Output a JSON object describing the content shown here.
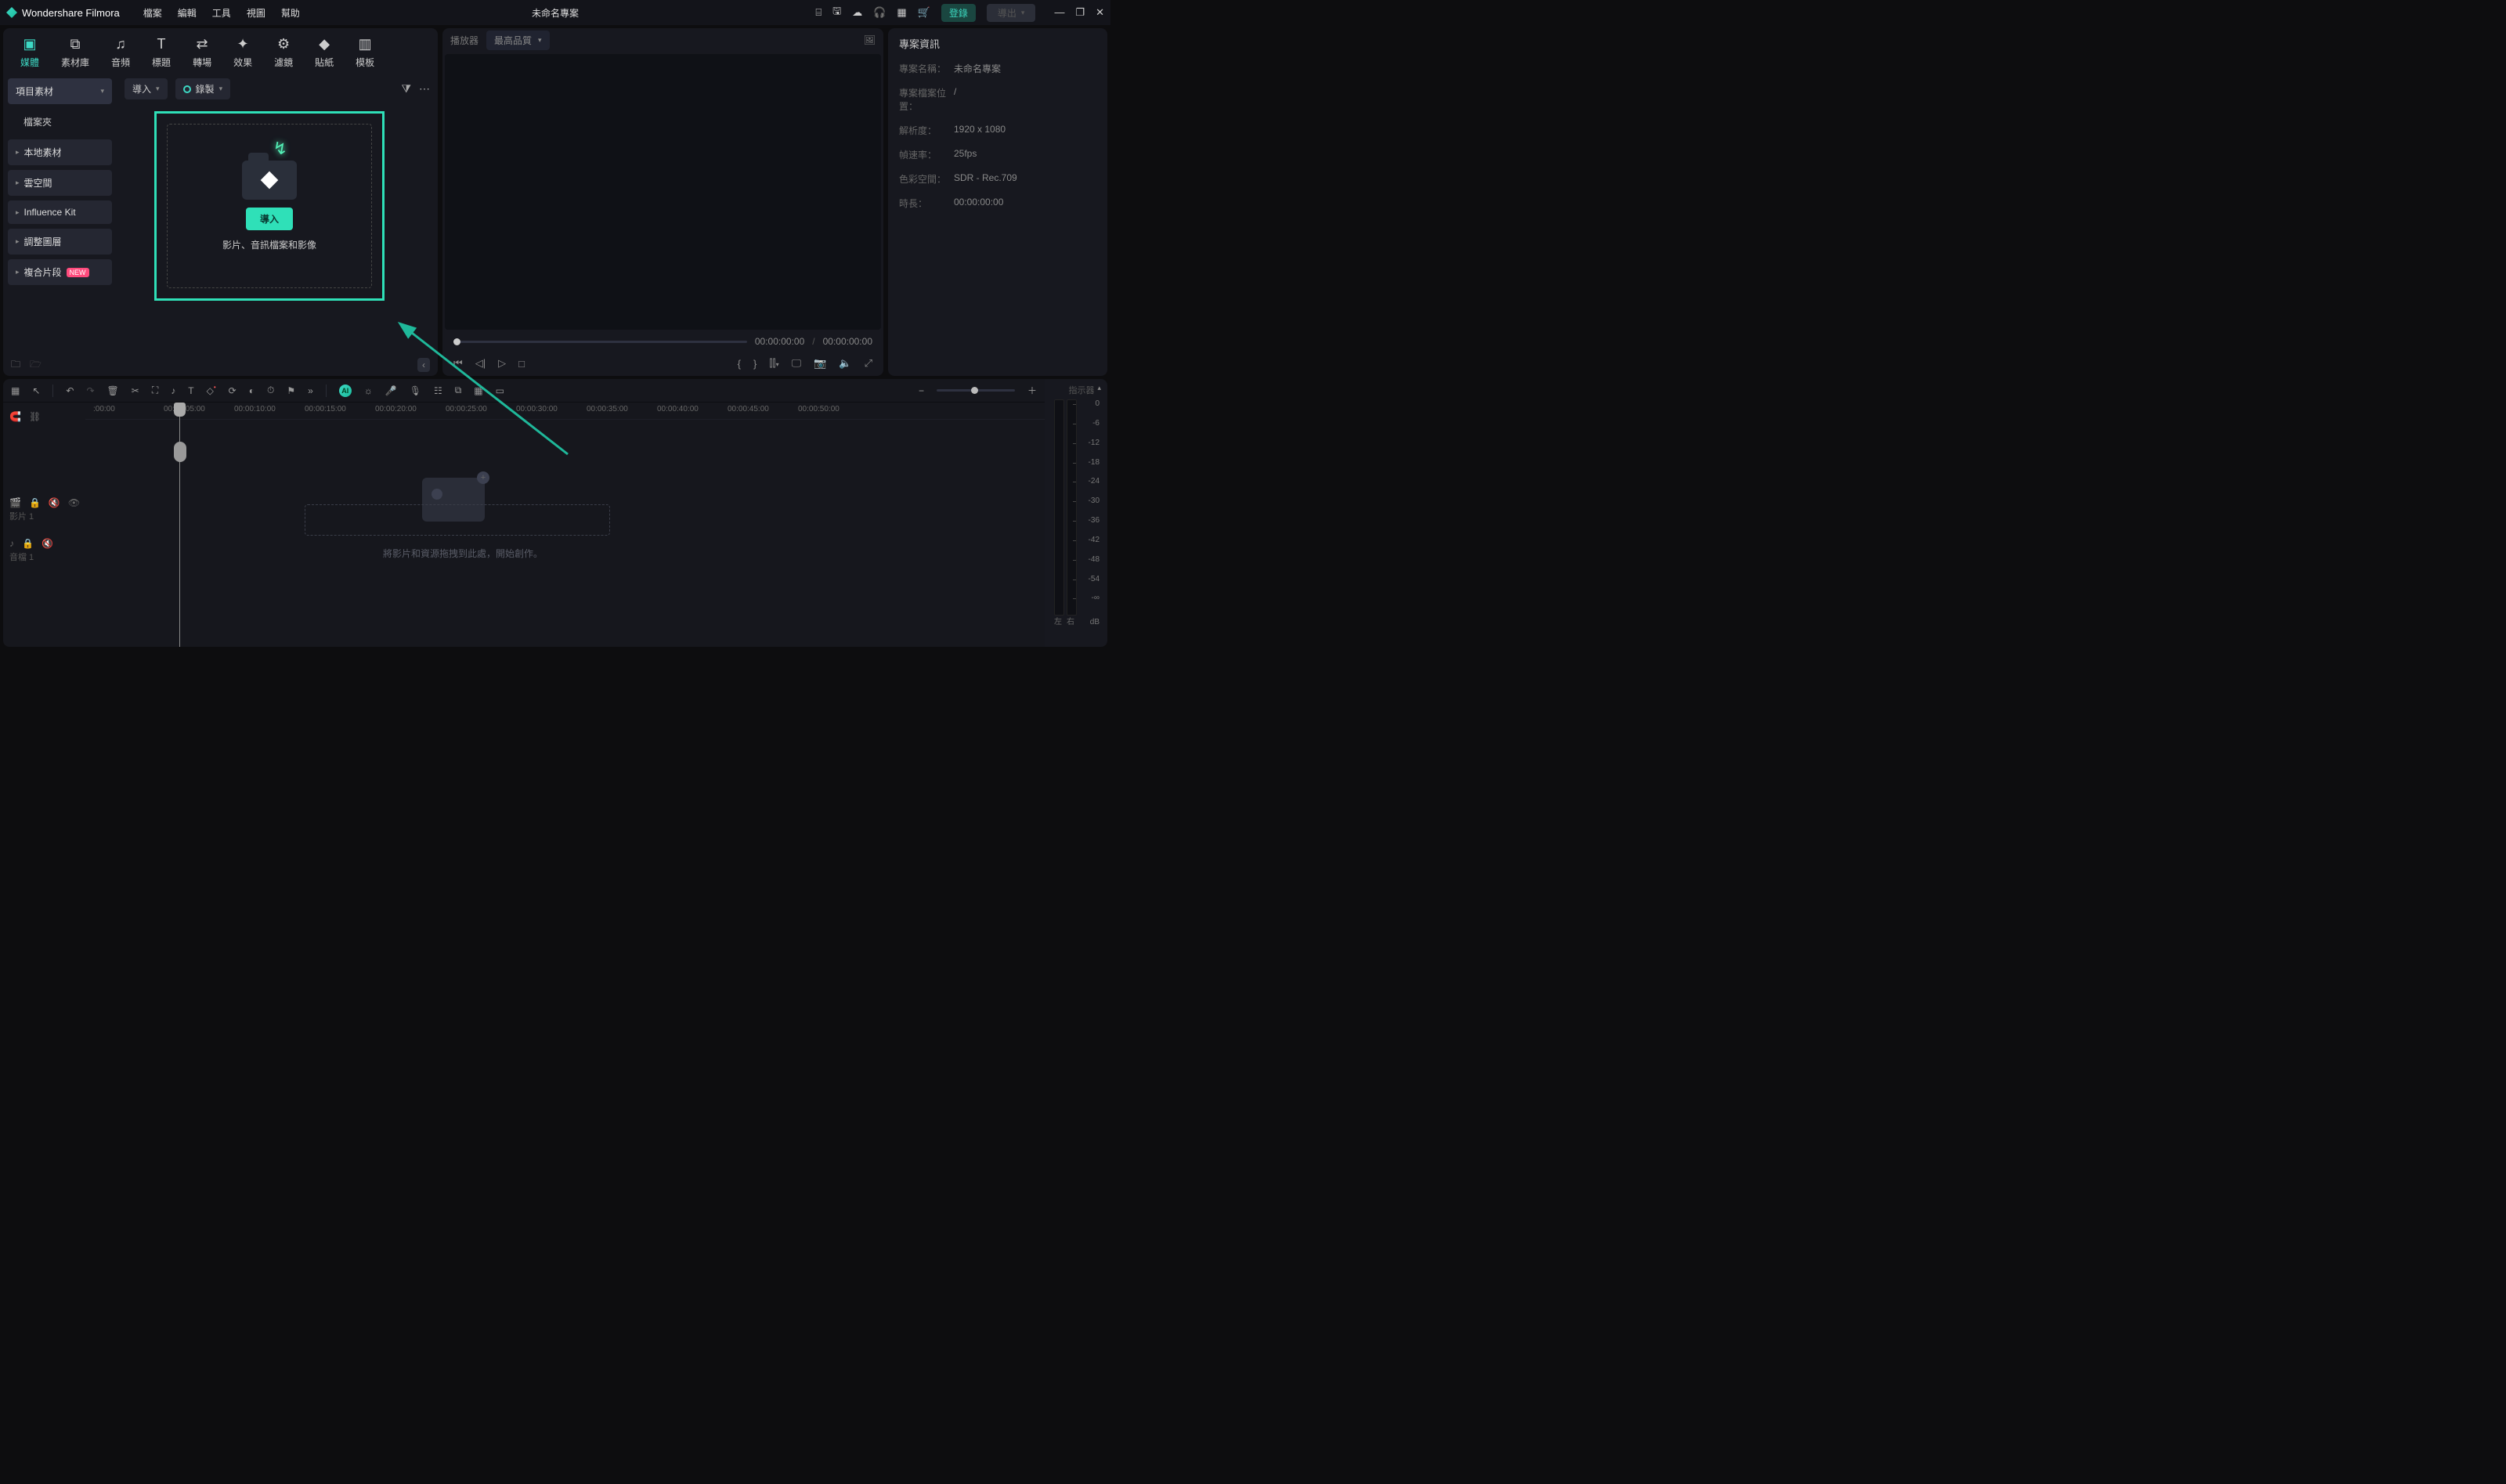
{
  "app": {
    "name": "Wondershare Filmora",
    "project_title": "未命名專案"
  },
  "titlemenu": {
    "file": "檔案",
    "edit": "編輯",
    "tool": "工具",
    "view": "視圖",
    "help": "幫助"
  },
  "titleright": {
    "login": "登錄",
    "export": "導出"
  },
  "tabs": {
    "media": "媒體",
    "stock": "素材庫",
    "audio": "音頻",
    "title": "標題",
    "trans": "轉場",
    "effect": "效果",
    "filter": "濾鏡",
    "sticker": "貼紙",
    "template": "模板"
  },
  "sidebar": {
    "project": "項目素材",
    "folder": "檔案夾",
    "local": "本地素材",
    "cloud": "雲空間",
    "influence": "Influence Kit",
    "adjust": "調整圖層",
    "compound": "複合片段",
    "new": "NEW"
  },
  "media": {
    "import": "導入",
    "record": "錄製",
    "import_btn": "導入",
    "caption": "影片、音訊檔案和影像"
  },
  "player": {
    "label": "播放器",
    "quality": "最高品質",
    "time_cur": "00:00:00:00",
    "time_dur": "00:00:00:00",
    "sep": "/"
  },
  "info": {
    "title": "專案資訊",
    "name_l": "專案名稱：",
    "name_v": "未命名專案",
    "path_l": "專案檔案位置：",
    "path_v": "/",
    "res_l": "解析度：",
    "res_v": "1920 x 1080",
    "fps_l": "幀速率：",
    "fps_v": "25fps",
    "cs_l": "色彩空間：",
    "cs_v": "SDR - Rec.709",
    "dur_l": "時長：",
    "dur_v": "00:00:00:00"
  },
  "timeline": {
    "marks": [
      ":00:00",
      "00:00:05:00",
      "00:00:10:00",
      "00:00:15:00",
      "00:00:20:00",
      "00:00:25:00",
      "00:00:30:00",
      "00:00:35:00",
      "00:00:40:00",
      "00:00:45:00",
      "00:00:50:00"
    ],
    "video_track": "影片 1",
    "audio_track": "音檔 1",
    "drop_hint": "將影片和資源拖拽到此處，開始創作。"
  },
  "meter": {
    "head": "指示器",
    "scale": [
      "0",
      "-6",
      "-12",
      "-18",
      "-24",
      "-30",
      "-36",
      "-42",
      "-48",
      "-54",
      "-∞"
    ],
    "left": "左",
    "right": "右",
    "db": "dB"
  }
}
